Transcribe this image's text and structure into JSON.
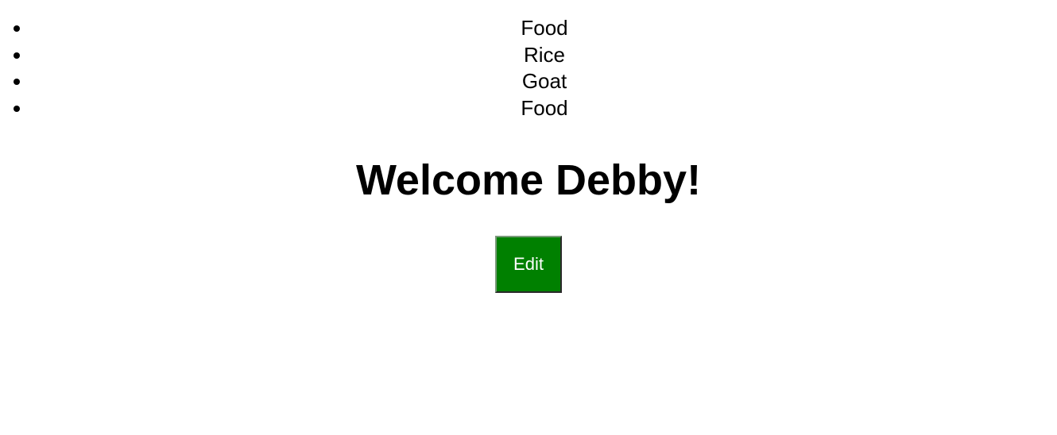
{
  "list": {
    "items": [
      "Food",
      "Rice",
      "Goat",
      "Food"
    ]
  },
  "heading": "Welcome Debby!",
  "edit_button": {
    "label": "Edit",
    "color": "#008000"
  }
}
